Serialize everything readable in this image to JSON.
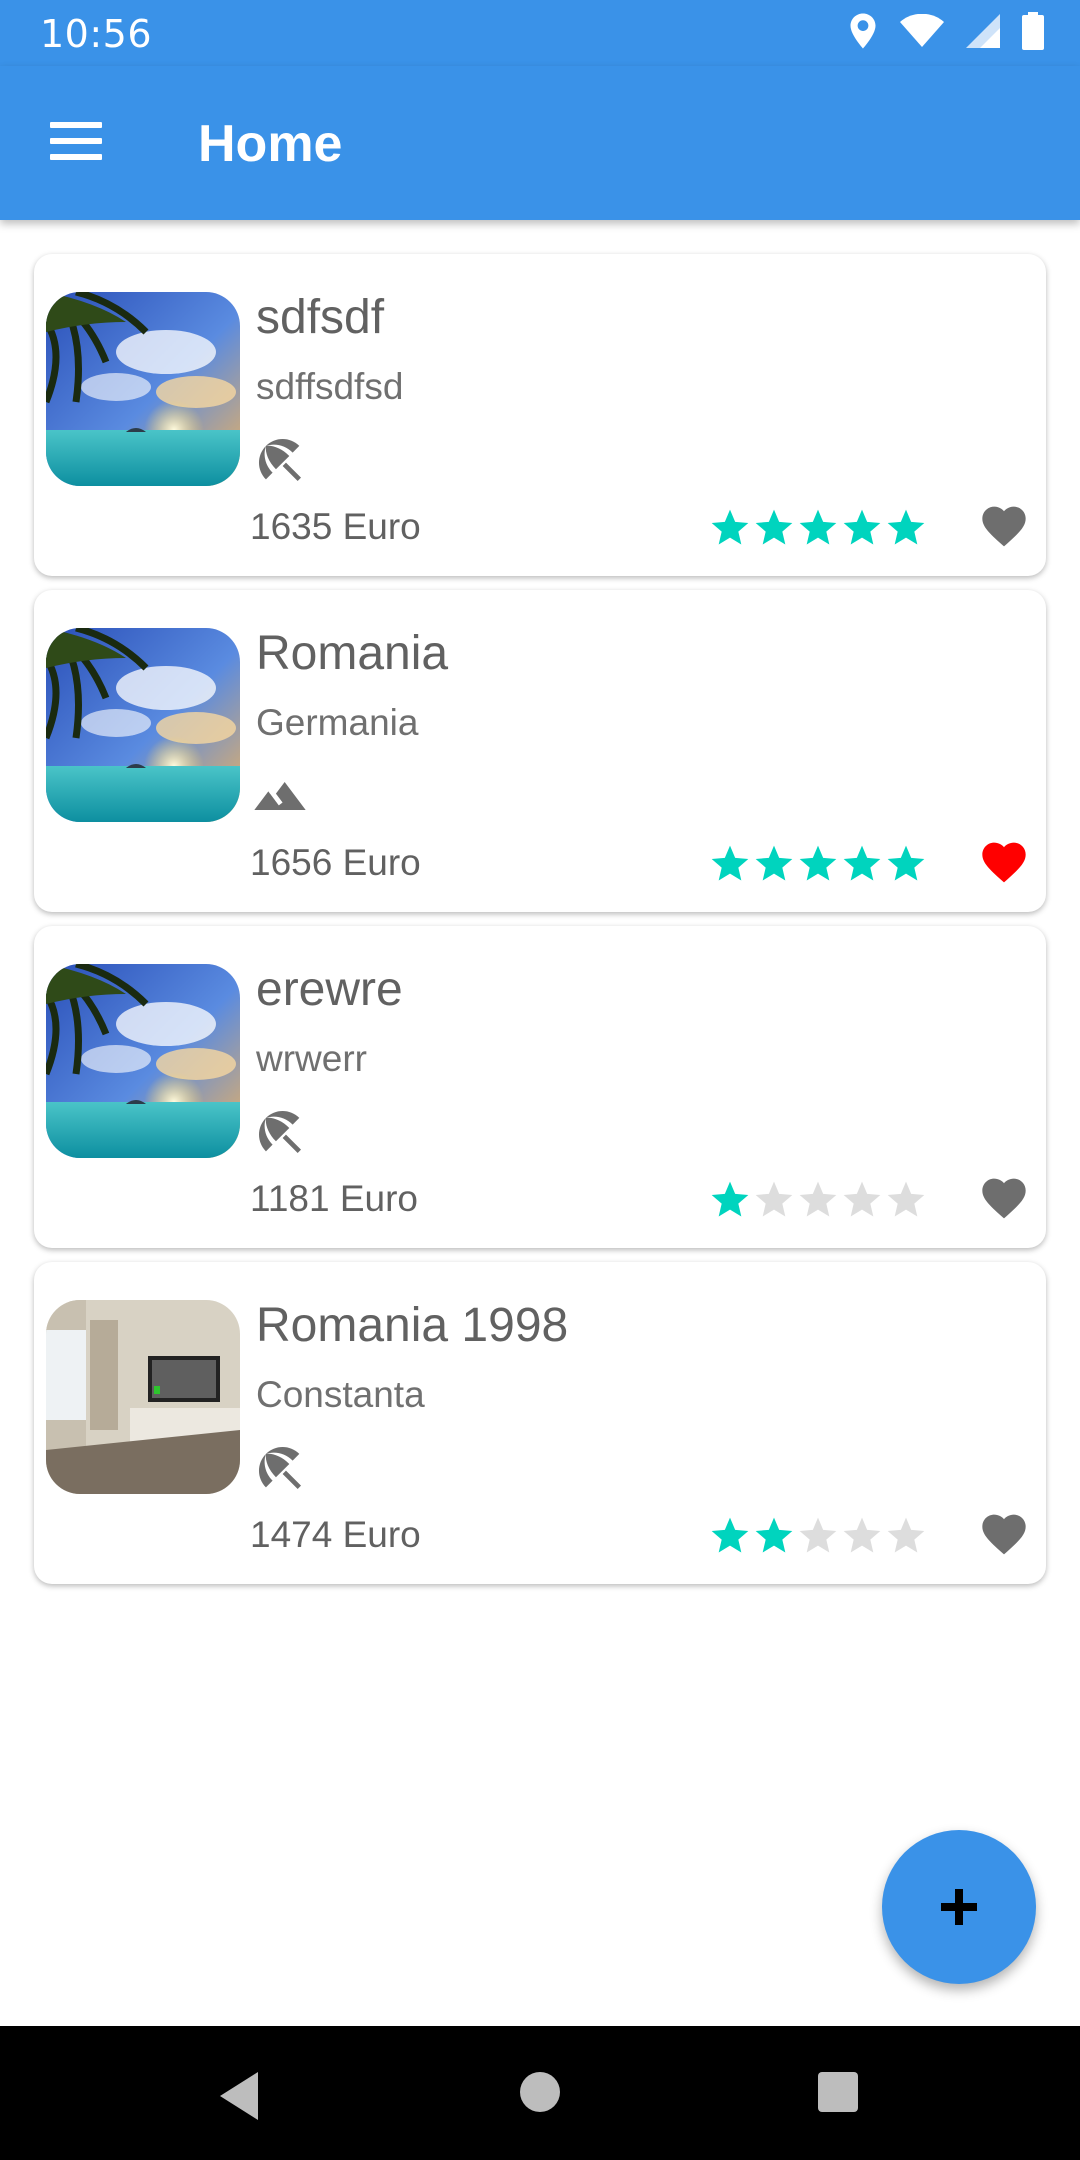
{
  "status_bar": {
    "time": "10:56",
    "icons": [
      "location-icon",
      "wifi-icon",
      "signal-icon",
      "battery-icon"
    ]
  },
  "app_bar": {
    "title": "Home",
    "menu_icon": "menu-icon"
  },
  "colors": {
    "primary": "#3a92e8",
    "star_filled": "#00d4be",
    "star_empty": "#dddddd",
    "heart_default": "#6e6e6e",
    "heart_favorite": "#ff0000"
  },
  "trips": [
    {
      "title": "sdfsdf",
      "subtitle": "sdffsdfsd",
      "type_icon": "beach-umbrella-icon",
      "price": "1635 Euro",
      "rating": 5,
      "favorite": false,
      "image": "palm-beach-sunset"
    },
    {
      "title": "Romania",
      "subtitle": "Germania",
      "type_icon": "mountain-icon",
      "price": "1656 Euro",
      "rating": 5,
      "favorite": true,
      "image": "palm-beach-sunset"
    },
    {
      "title": "erewre",
      "subtitle": "wrwerr",
      "type_icon": "beach-umbrella-icon",
      "price": "1181 Euro",
      "rating": 1,
      "favorite": false,
      "image": "palm-beach-sunset"
    },
    {
      "title": "Romania 1998",
      "subtitle": "Constanta",
      "type_icon": "beach-umbrella-icon",
      "price": "1474 Euro",
      "rating": 2,
      "favorite": false,
      "image": "room-interior"
    }
  ],
  "fab": {
    "icon": "add-icon"
  },
  "nav_bar": {
    "icons": [
      "back-icon",
      "home-icon",
      "recents-icon"
    ]
  }
}
